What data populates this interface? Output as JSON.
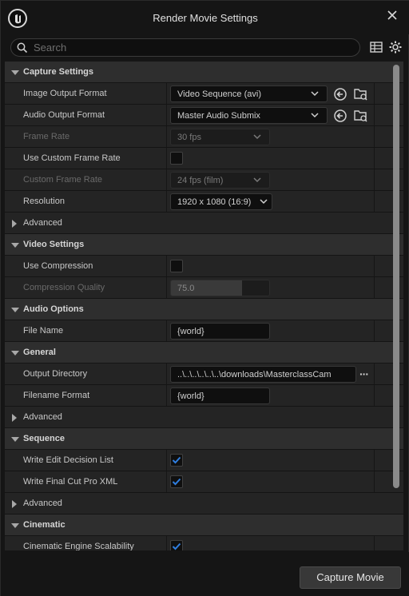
{
  "window": {
    "title": "Render Movie Settings"
  },
  "search": {
    "placeholder": "Search"
  },
  "rows": {
    "capture_settings": "Capture Settings",
    "image_output_format": {
      "label": "Image Output Format",
      "value": "Video Sequence (avi)"
    },
    "audio_output_format": {
      "label": "Audio Output Format",
      "value": "Master Audio Submix"
    },
    "frame_rate": {
      "label": "Frame Rate",
      "value": "30 fps"
    },
    "use_custom_frame_rate": {
      "label": "Use Custom Frame Rate",
      "checked": false
    },
    "custom_frame_rate": {
      "label": "Custom Frame Rate",
      "value": "24 fps (film)"
    },
    "resolution": {
      "label": "Resolution",
      "value": "1920 x 1080 (16:9)"
    },
    "advanced_1": "Advanced",
    "video_settings": "Video Settings",
    "use_compression": {
      "label": "Use Compression",
      "checked": false
    },
    "compression_quality": {
      "label": "Compression Quality",
      "value": "75.0",
      "fill_fraction": 0.72
    },
    "audio_options": "Audio Options",
    "audio_file_name": {
      "label": "File Name",
      "value": "{world}"
    },
    "general": "General",
    "output_directory": {
      "label": "Output Directory",
      "value": "..\\..\\..\\..\\..\\..\\downloads\\MasterclassCam"
    },
    "filename_format": {
      "label": "Filename Format",
      "value": "{world}"
    },
    "advanced_2": "Advanced",
    "sequence": "Sequence",
    "write_edl": {
      "label": "Write Edit Decision List",
      "checked": true
    },
    "write_fcp_xml": {
      "label": "Write Final Cut Pro XML",
      "checked": true
    },
    "advanced_3": "Advanced",
    "cinematic": "Cinematic",
    "cinematic_engine_scalability": {
      "label": "Cinematic Engine Scalability",
      "checked": true
    }
  },
  "footer": {
    "capture_label": "Capture Movie"
  },
  "colors": {
    "check_accent": "#2f7ee0",
    "panel_bg": "#242424",
    "category_bg": "#2e2e2e"
  }
}
